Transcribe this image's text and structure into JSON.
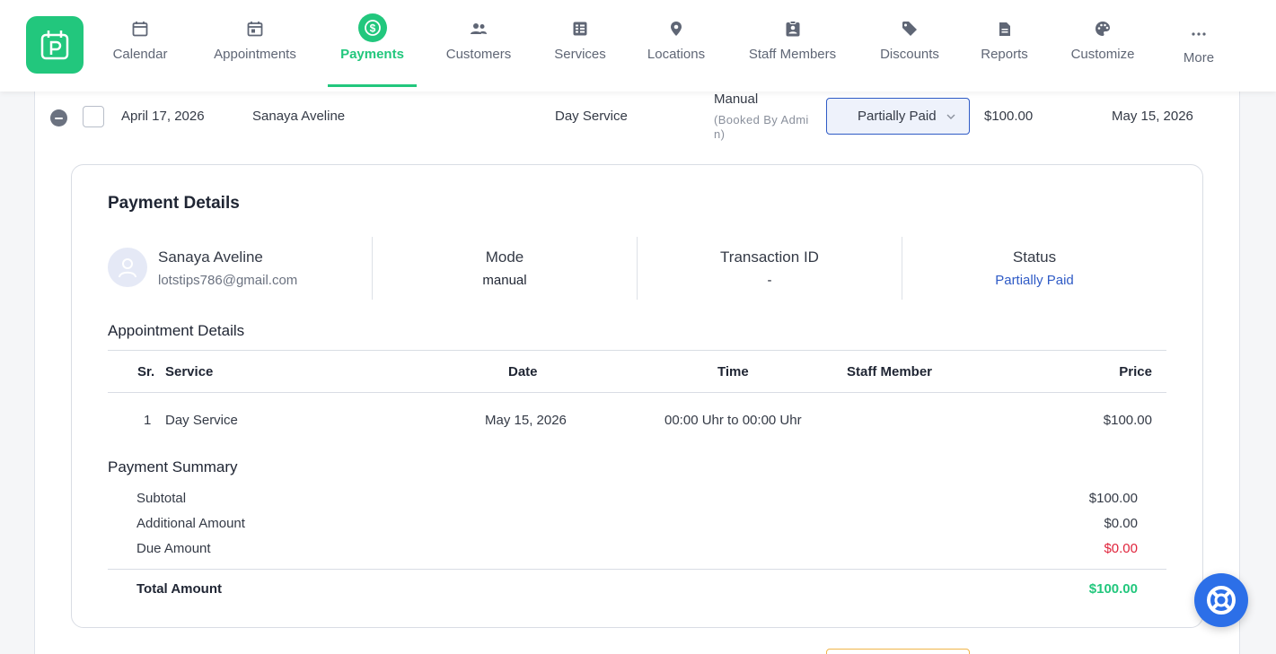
{
  "nav": {
    "items": [
      {
        "label": "Calendar",
        "icon": "calendar-icon"
      },
      {
        "label": "Appointments",
        "icon": "calendar-check-icon"
      },
      {
        "label": "Payments",
        "icon": "dollar-circle-icon",
        "active": true
      },
      {
        "label": "Customers",
        "icon": "users-icon"
      },
      {
        "label": "Services",
        "icon": "list-icon"
      },
      {
        "label": "Locations",
        "icon": "location-pin-icon"
      },
      {
        "label": "Staff Members",
        "icon": "id-badge-icon"
      },
      {
        "label": "Discounts",
        "icon": "tag-icon"
      },
      {
        "label": "Reports",
        "icon": "document-icon"
      },
      {
        "label": "Customize",
        "icon": "palette-icon"
      },
      {
        "label": "More",
        "icon": "ellipsis-icon"
      }
    ],
    "accent": "#22c77d"
  },
  "row": {
    "date": "April 17, 2026",
    "customer": "Sanaya Aveline",
    "service": "Day Service",
    "method": "Manual",
    "method_note": "(Booked By Admin)",
    "status": "Partially Paid",
    "amount": "$100.00",
    "due_date": "May 15, 2026"
  },
  "details": {
    "title": "Payment Details",
    "customer_name": "Sanaya Aveline",
    "customer_email": "lotstips786@gmail.com",
    "mode_label": "Mode",
    "mode_value": "manual",
    "txn_label": "Transaction ID",
    "txn_value": "-",
    "status_label": "Status",
    "status_value": "Partially Paid",
    "status_color": "#2f5bc6"
  },
  "appointment": {
    "title": "Appointment Details",
    "headers": {
      "sr": "Sr.",
      "service": "Service",
      "date": "Date",
      "time": "Time",
      "staff": "Staff Member",
      "price": "Price"
    },
    "rows": [
      {
        "sr": "1",
        "service": "Day Service",
        "date": "May 15, 2026",
        "time": "00:00 Uhr to 00:00 Uhr",
        "staff": "",
        "price": "$100.00"
      }
    ]
  },
  "summary": {
    "title": "Payment Summary",
    "subtotal_label": "Subtotal",
    "subtotal": "$100.00",
    "additional_label": "Additional Amount",
    "additional": "$0.00",
    "due_label": "Due Amount",
    "due": "$0.00",
    "due_color": "#e0243c",
    "total_label": "Total Amount",
    "total": "$100.00",
    "total_color": "#22c77d"
  },
  "help": {
    "icon": "lifebuoy-icon",
    "color": "#2c6fe8"
  }
}
